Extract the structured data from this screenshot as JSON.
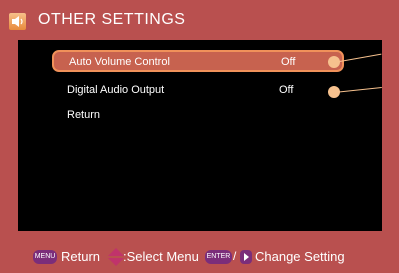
{
  "header": {
    "title": "OTHER SETTINGS",
    "icon": "speaker-icon"
  },
  "menu": {
    "items": [
      {
        "label": "Auto Volume Control",
        "value": "Off"
      },
      {
        "label": "Digital Audio Output",
        "value": "Off"
      },
      {
        "label": "Return",
        "value": ""
      }
    ],
    "selected_index": 0
  },
  "footer": {
    "menu_key": "MENU",
    "return_label": "Return",
    "select_label": ":Select Menu",
    "enter_key": "ENTER",
    "slash": "/",
    "change_label": "Change Setting"
  },
  "colors": {
    "background": "#b9504f",
    "panel": "#000000",
    "highlight": "#c7624f",
    "highlight_border": "#f0915a",
    "key": "#7b2d7a",
    "accent": "#f6c18e"
  }
}
